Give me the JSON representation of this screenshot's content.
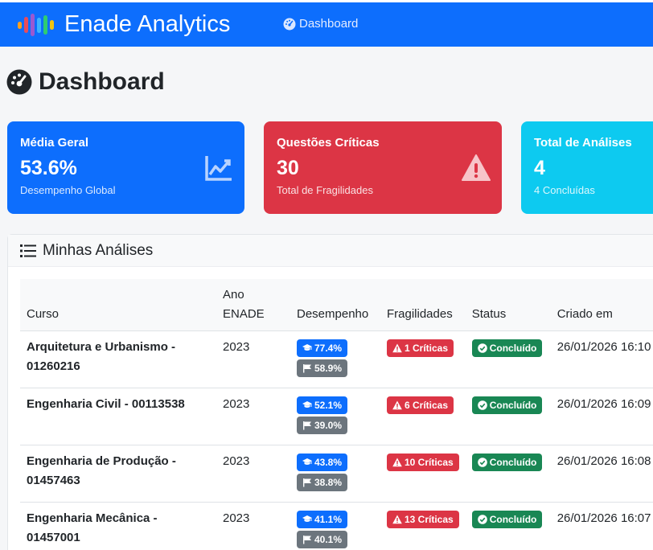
{
  "brand": {
    "title": "Enade Analytics",
    "colors": [
      "#ff9f1a",
      "#e74c5b",
      "#9b59d0",
      "#3db1ff",
      "#2ecc71",
      "#f1c40f"
    ]
  },
  "nav": {
    "dashboard_label": "Dashboard",
    "icon": "speedometer-icon"
  },
  "page": {
    "title": "Dashboard",
    "icon": "speedometer-icon"
  },
  "stats": [
    {
      "label": "Média Geral",
      "value": "53.6%",
      "sub": "Desempenho Global",
      "icon": "line-chart-icon",
      "color": "#0d6efd"
    },
    {
      "label": "Questões Críticas",
      "value": "30",
      "sub": "Total de Fragilidades",
      "icon": "warning-icon",
      "color": "#dc3545"
    },
    {
      "label": "Total de Análises",
      "value": "4",
      "sub": "4 Concluídas",
      "icon": "",
      "color": "#0dcaf0"
    }
  ],
  "analyses": {
    "title": "Minhas Análises",
    "icon": "list-icon",
    "columns": [
      "Curso",
      "Ano ENADE",
      "Desempenho",
      "Fragilidades",
      "Status",
      "Criado em"
    ],
    "rows": [
      {
        "curso": "Arquitetura e Urbanismo - 01260216",
        "ano": "2023",
        "desempenho": "77.4%",
        "geral": "58.9%",
        "fragilidades": "1 Críticas",
        "status": "Concluído",
        "criado": "26/01/2026 16:10"
      },
      {
        "curso": "Engenharia Civil - 00113538",
        "ano": "2023",
        "desempenho": "52.1%",
        "geral": "39.0%",
        "fragilidades": "6 Críticas",
        "status": "Concluído",
        "criado": "26/01/2026 16:09"
      },
      {
        "curso": "Engenharia de Produção - 01457463",
        "ano": "2023",
        "desempenho": "43.8%",
        "geral": "38.8%",
        "fragilidades": "10 Críticas",
        "status": "Concluído",
        "criado": "26/01/2026 16:08"
      },
      {
        "curso": "Engenharia Mecânica - 01457001",
        "ano": "2023",
        "desempenho": "41.1%",
        "geral": "40.1%",
        "fragilidades": "13 Críticas",
        "status": "Concluído",
        "criado": "26/01/2026 16:07"
      }
    ]
  }
}
